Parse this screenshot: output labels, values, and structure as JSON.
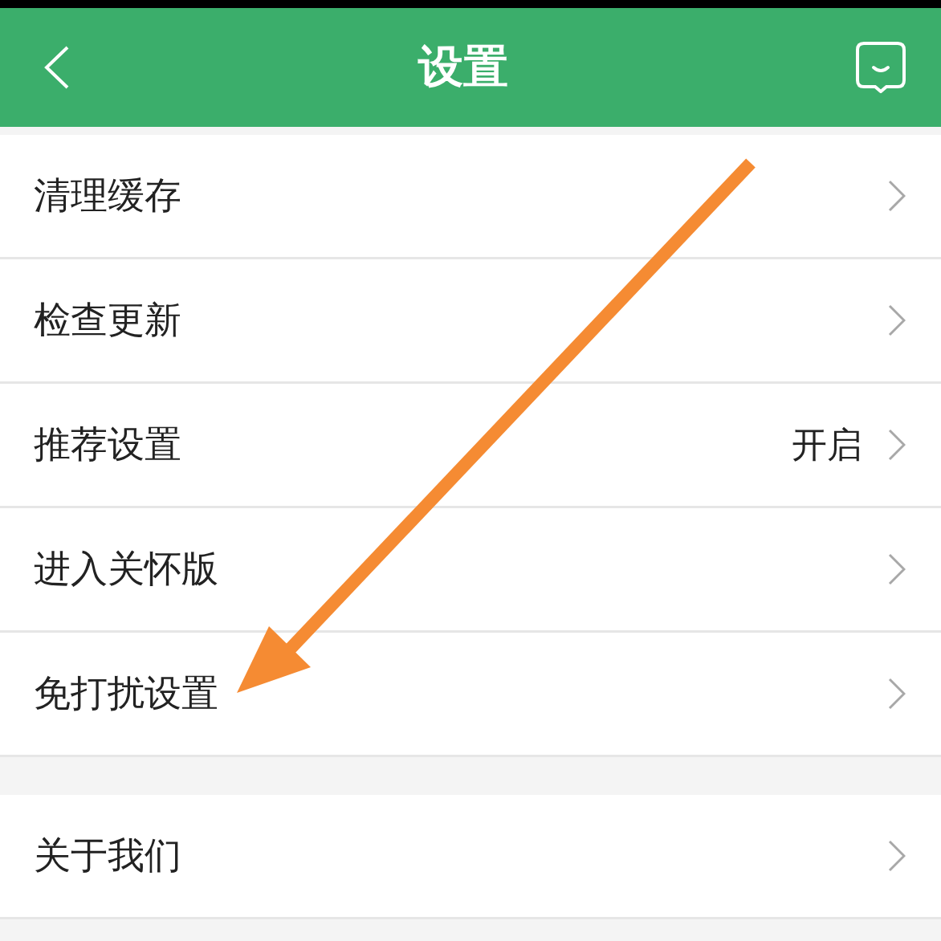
{
  "header": {
    "title": "设置"
  },
  "groups": [
    {
      "items": [
        {
          "label": "清理缓存"
        },
        {
          "label": "检查更新"
        },
        {
          "label": "推荐设置",
          "value": "开启"
        },
        {
          "label": "进入关怀版"
        },
        {
          "label": "免打扰设置"
        }
      ]
    },
    {
      "items": [
        {
          "label": "关于我们"
        }
      ]
    }
  ]
}
